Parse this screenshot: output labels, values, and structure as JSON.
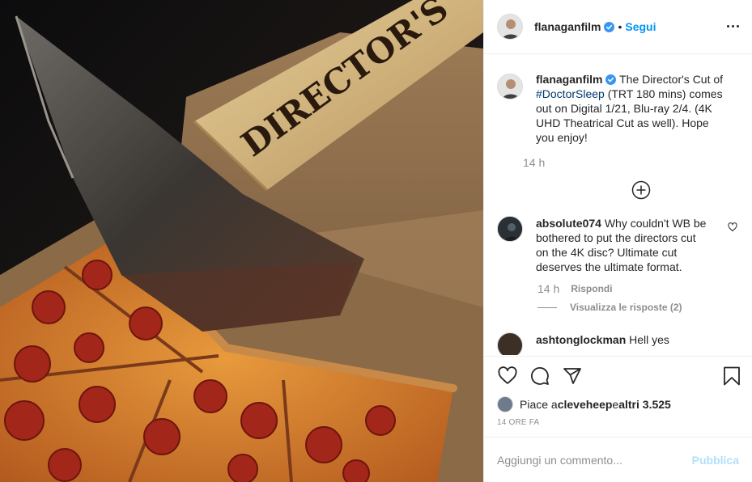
{
  "photo": {
    "axe_text": "DIRECTOR'S"
  },
  "post": {
    "author": "flanaganfilm",
    "follow_separator": "•",
    "follow_label": "Segui",
    "caption": {
      "author": "flanaganfilm",
      "text_before": " The Director's Cut of ",
      "hashtag": "#DoctorSleep",
      "text_after": " (TRT 180 mins) comes out on Digital 1/21, Blu-ray 2/4. (4K UHD Theatrical Cut as well). Hope you enjoy!",
      "time": "14 h"
    },
    "comments": [
      {
        "user": "absolute074",
        "text": " Why couldn't WB be bothered to put the directors cut on the 4K disc? Ultimate cut deserves the ultimate format.",
        "time": "14 h",
        "reply_label": "Rispondi",
        "view_replies": "Visualizza le risposte (2)"
      },
      {
        "user": "ashtonglockman",
        "text": " Hell yes"
      }
    ],
    "likes": {
      "prefix": "Piace a ",
      "user": "cleveheep",
      "middle": " e ",
      "others": "altri 3.525"
    },
    "timestamp": "14 ORE FA",
    "comment_input_placeholder": "Aggiungi un commento...",
    "publish_label": "Pubblica"
  },
  "colors": {
    "link": "#0095f6",
    "hashtag": "#00376b",
    "muted": "#8e8e8e",
    "publish_disabled": "#b2dffc"
  },
  "icons": [
    "more-options-icon",
    "verified-badge-icon",
    "load-more-icon",
    "heart-icon",
    "comment-icon",
    "share-icon",
    "bookmark-icon"
  ]
}
